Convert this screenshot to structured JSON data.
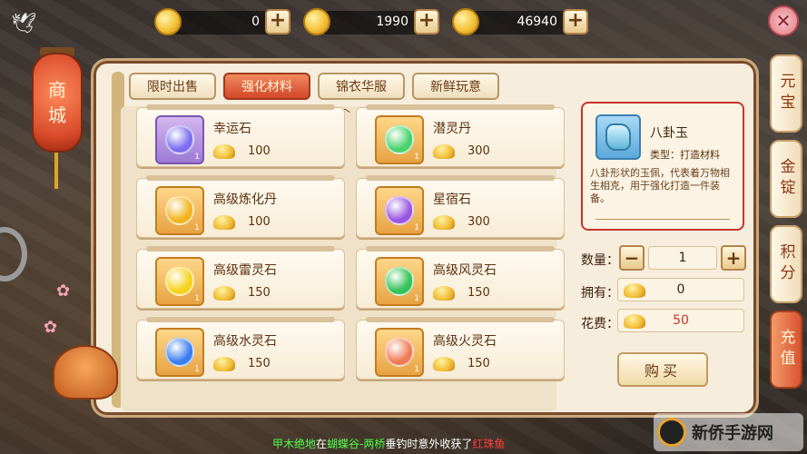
{
  "currency": [
    {
      "icon": "gold-ingot-icon",
      "value": "0",
      "add": "+"
    },
    {
      "icon": "gold-bar-icon",
      "value": "1990",
      "add": "+"
    },
    {
      "icon": "coin-icon",
      "value": "46940",
      "add": "+"
    }
  ],
  "lantern": {
    "line1": "商",
    "line2": "城"
  },
  "tabs": [
    {
      "label": "限时出售",
      "active": false
    },
    {
      "label": "强化材料",
      "active": true
    },
    {
      "label": "锦衣华服",
      "active": false
    },
    {
      "label": "新鲜玩意",
      "active": false
    }
  ],
  "items": [
    {
      "name": "幸运石",
      "price": "100",
      "count": "1",
      "color": "#7b6ef0",
      "frame": "purple"
    },
    {
      "name": "潜灵丹",
      "price": "300",
      "count": "1",
      "color": "#47d26b",
      "frame": "gold"
    },
    {
      "name": "高级炼化丹",
      "price": "100",
      "count": "1",
      "color": "#f2b31f",
      "frame": "gold"
    },
    {
      "name": "星宿石",
      "price": "300",
      "count": "1",
      "color": "#9a55e0",
      "frame": "gold"
    },
    {
      "name": "高级雷灵石",
      "price": "150",
      "count": "1",
      "color": "#f6d21a",
      "frame": "gold"
    },
    {
      "name": "高级风灵石",
      "price": "150",
      "count": "1",
      "color": "#32c255",
      "frame": "gold"
    },
    {
      "name": "高级水灵石",
      "price": "150",
      "count": "1",
      "color": "#3a7ff0",
      "frame": "gold"
    },
    {
      "name": "高级火灵石",
      "price": "150",
      "count": "1",
      "color": "#f07a55",
      "frame": "gold"
    }
  ],
  "detail": {
    "name": "八卦玉",
    "type": "类型：打造材料",
    "desc": "八卦形状的玉佩，代表着万物相生相克，用于强化打造一件装备。"
  },
  "purchase": {
    "qty_label": "数量：",
    "qty": "1",
    "minus": "−",
    "plus": "+",
    "own_label": "拥有：",
    "own": "0",
    "cost_label": "花费：",
    "cost": "50",
    "buy": "购买"
  },
  "side_tabs": [
    {
      "label": "元宝",
      "active": false
    },
    {
      "label": "金锭",
      "active": false
    },
    {
      "label": "积分",
      "active": false
    },
    {
      "label": "充值",
      "active": true
    }
  ],
  "close": "✕",
  "chat": {
    "p1": "甲木绝地",
    "p2": "在",
    "p3": "蝴蝶谷-两桥",
    "p4": "垂钓时意外收获了",
    "p5": "红珠鱼"
  },
  "watermark": "新侨手游网"
}
